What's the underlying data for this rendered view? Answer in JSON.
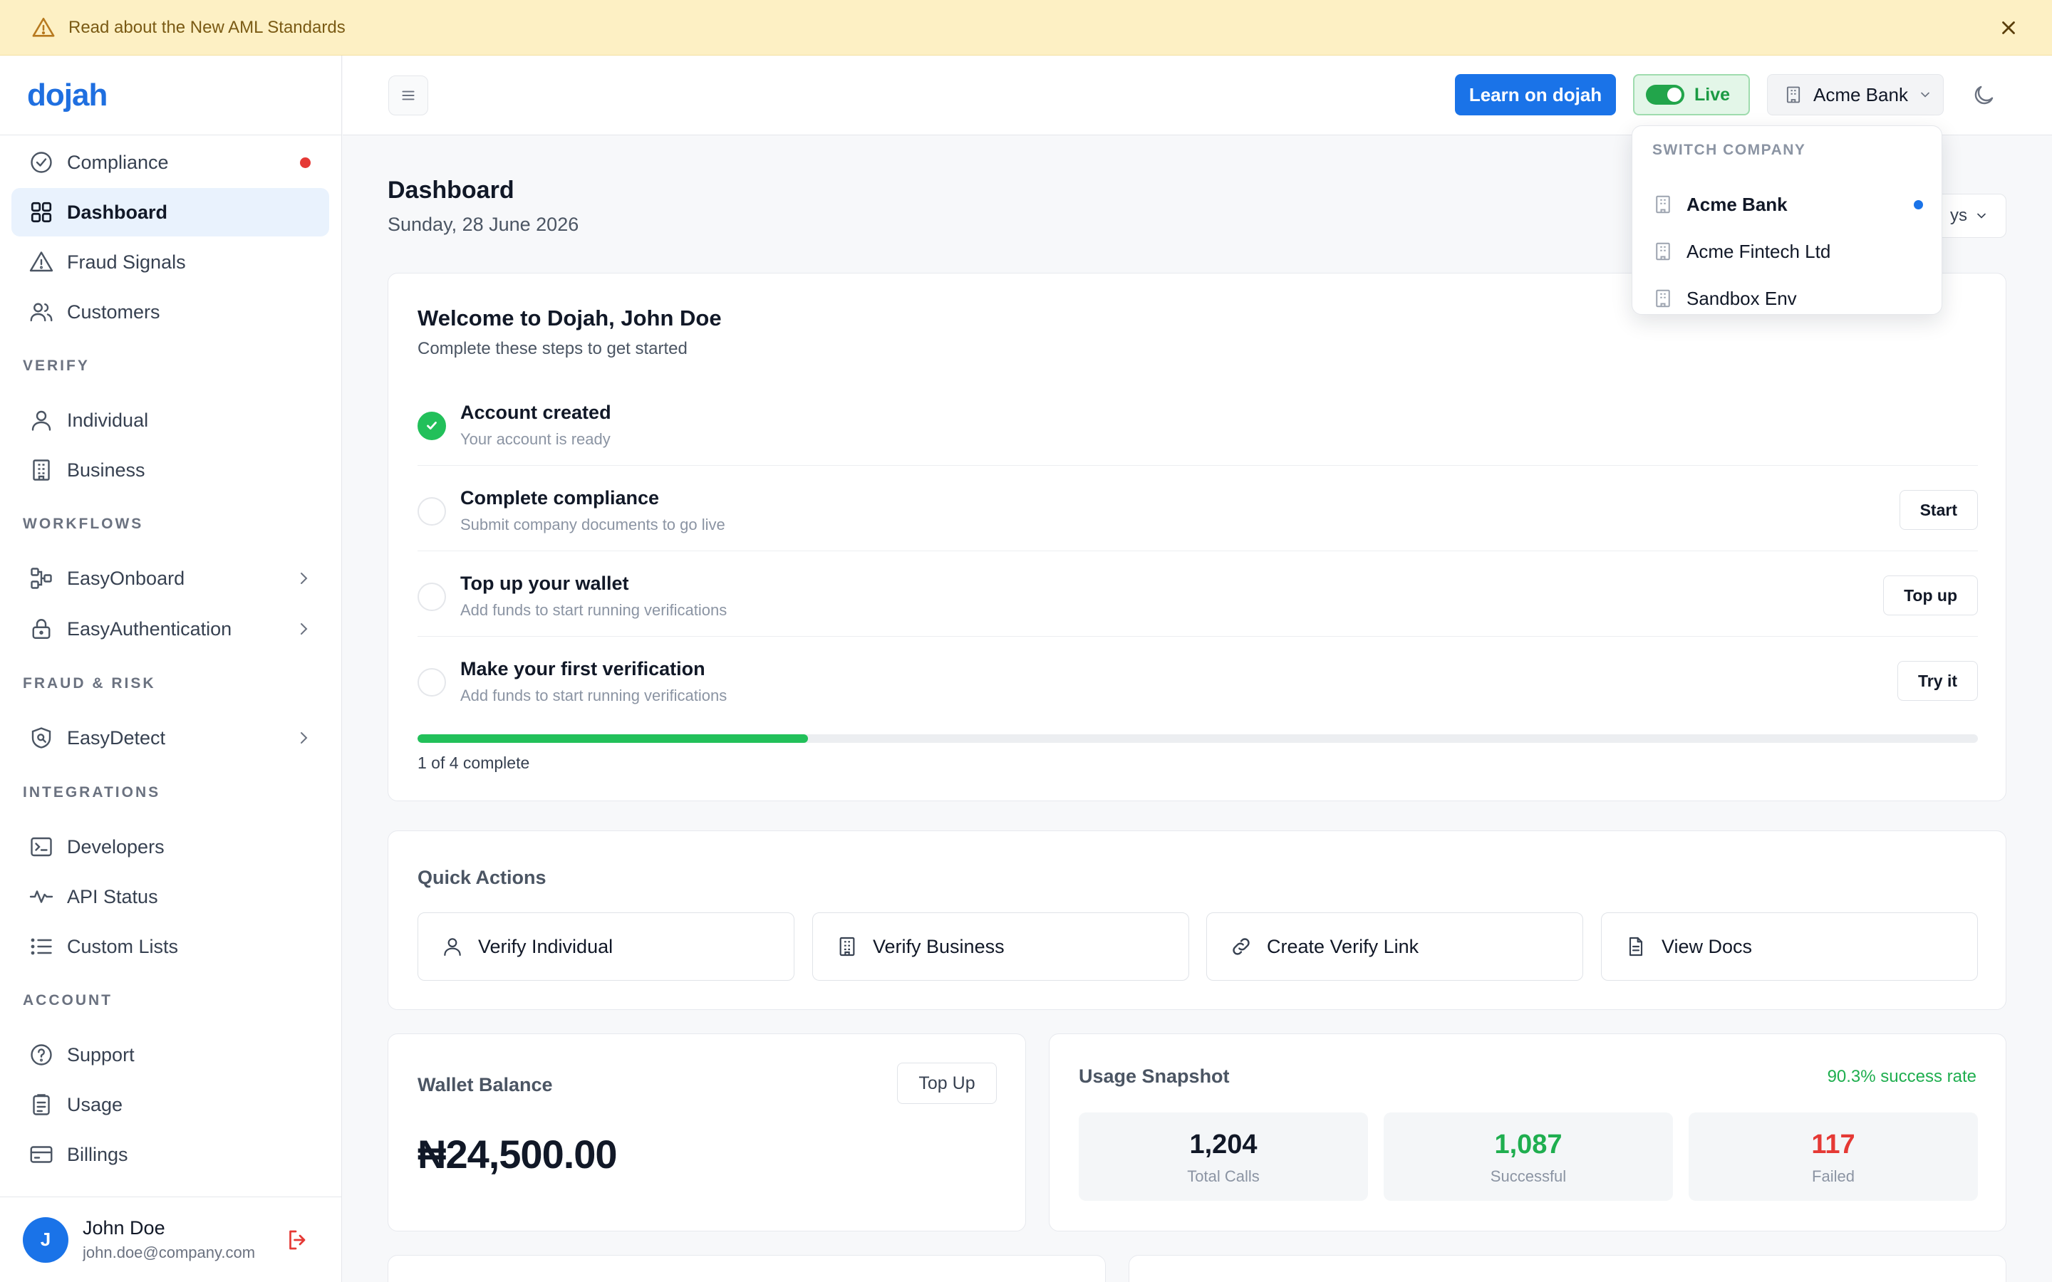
{
  "banner": {
    "text": "Read about the New AML Standards"
  },
  "sidebar": {
    "logo": "dojah",
    "sections": {
      "verify": "VERIFY",
      "workflows": "WORKFLOWS",
      "fraud": "FRAUD & RISK",
      "integrations": "INTEGRATIONS",
      "account": "ACCOUNT"
    },
    "items": {
      "compliance": "Compliance",
      "dashboard": "Dashboard",
      "fraud_signals": "Fraud Signals",
      "customers": "Customers",
      "individual": "Individual",
      "business": "Business",
      "easyonboard": "EasyOnboard",
      "easyauth": "EasyAuthentication",
      "easydetect": "EasyDetect",
      "developers": "Developers",
      "api_status": "API Status",
      "custom_lists": "Custom Lists",
      "support": "Support",
      "usage": "Usage",
      "billings": "Billings"
    },
    "user": {
      "initial": "J",
      "name": "John Doe",
      "email": "john.doe@company.com"
    }
  },
  "topbar": {
    "learn_label": "Learn on dojah",
    "live_label": "Live",
    "company_label": "Acme Bank"
  },
  "page": {
    "title": "Dashboard",
    "date": "Sunday, 28 June 2026",
    "range_label": "ys"
  },
  "welcome": {
    "title": "Welcome to Dojah, John Doe",
    "subtitle": "Complete these steps to get started",
    "steps": [
      {
        "title": "Account created",
        "desc": "Your account is ready",
        "done": true
      },
      {
        "title": "Complete compliance",
        "desc": "Submit company documents to go live",
        "button": "Start"
      },
      {
        "title": "Top up your wallet",
        "desc": "Add funds to start running verifications",
        "button": "Top up"
      },
      {
        "title": "Make your first verification",
        "desc": "Add funds to start running verifications",
        "button": "Try it"
      }
    ],
    "progress_fraction": 0.25,
    "progress_label": "1 of 4 complete"
  },
  "quick_actions": {
    "title": "Quick Actions",
    "items": [
      "Verify Individual",
      "Verify Business",
      "Create Verify Link",
      "View Docs"
    ]
  },
  "wallet": {
    "title": "Wallet Balance",
    "button": "Top Up",
    "amount": "₦24,500.00"
  },
  "usage": {
    "title": "Usage Snapshot",
    "rate": "90.3% success rate",
    "stats": [
      {
        "value": "1,204",
        "label": "Total Calls",
        "color": "#111827"
      },
      {
        "value": "1,087",
        "label": "Successful",
        "color": "#1fae4f"
      },
      {
        "value": "117",
        "label": "Failed",
        "color": "#e53935"
      }
    ]
  },
  "company_dropdown": {
    "heading": "SWITCH COMPANY",
    "options": [
      "Acme Bank",
      "Acme Fintech Ltd",
      "Sandbox Env"
    ],
    "selected": "Acme Bank"
  },
  "colors": {
    "accent": "#1a73e8",
    "success": "#22c05a",
    "danger": "#e53935",
    "banner": "#fdf0c4"
  }
}
